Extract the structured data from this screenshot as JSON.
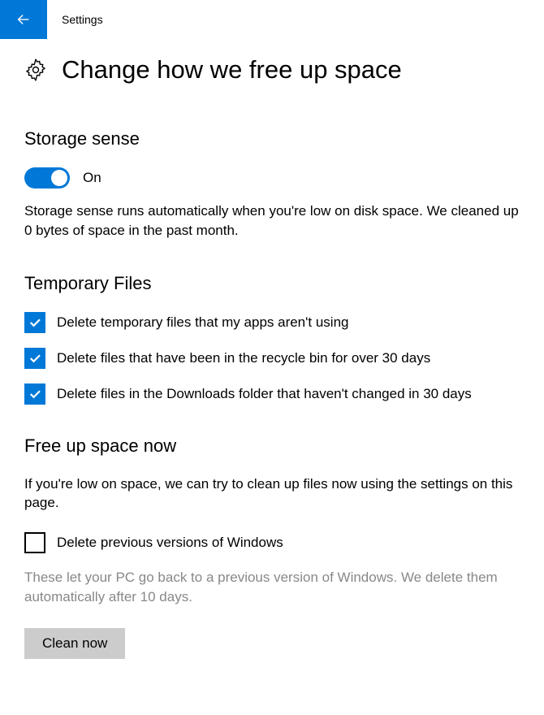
{
  "header": {
    "app_title": "Settings"
  },
  "page_title": "Change how we free up space",
  "storage_sense": {
    "heading": "Storage sense",
    "toggle_state": "On",
    "description": "Storage sense runs automatically when you're low on disk space. We cleaned up 0 bytes of space in the past month."
  },
  "temporary_files": {
    "heading": "Temporary Files",
    "items": [
      {
        "label": "Delete temporary files that my apps aren't using",
        "checked": true
      },
      {
        "label": "Delete files that have been in the recycle bin for over 30 days",
        "checked": true
      },
      {
        "label": "Delete files in the Downloads folder that haven't changed in 30 days",
        "checked": true
      }
    ]
  },
  "free_up": {
    "heading": "Free up space now",
    "intro": "If you're low on space, we can try to clean up files now using the settings on this page.",
    "delete_previous": {
      "label": "Delete previous versions of Windows",
      "checked": false
    },
    "help": "These let your PC go back to a previous version of Windows. We delete them automatically after 10 days.",
    "button_label": "Clean now"
  }
}
